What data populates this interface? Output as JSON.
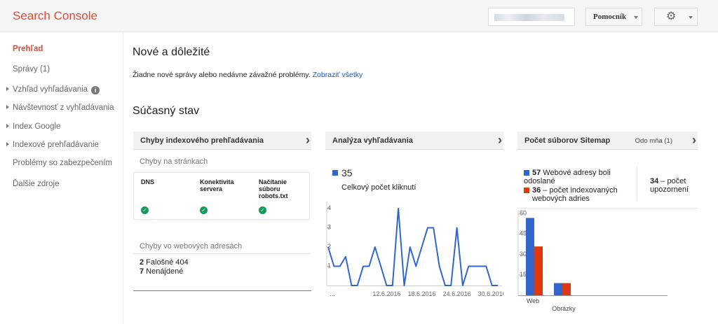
{
  "header": {
    "app_title": "Search Console",
    "help_label": "Pomocník"
  },
  "sidebar": {
    "items": [
      {
        "label": "Prehľad"
      },
      {
        "label": "Správy (1)"
      },
      {
        "label": "Vzhľad vyhľadávania"
      },
      {
        "label": "Návštevnosť z vyhľadávania"
      },
      {
        "label": "Index Google"
      },
      {
        "label": "Indexové prehľadávanie"
      },
      {
        "label": "Problémy so zabezpečením"
      },
      {
        "label": "Ďalšie zdroje"
      }
    ]
  },
  "main": {
    "news_title": "Nové a dôležité",
    "news_text": "Žiadne nové správy alebo nedávne závažné problémy.",
    "news_link": "Zobraziť všetky",
    "status_title": "Súčasný stav"
  },
  "crawl_errors": {
    "title": "Chyby indexového prehľadávania",
    "site_errors_label": "Chyby na stránkach",
    "columns": [
      {
        "lines": [
          "DNS"
        ]
      },
      {
        "lines": [
          "Konektivita",
          "servera"
        ]
      },
      {
        "lines": [
          "Načítanie",
          "súboru",
          "robots.txt"
        ]
      }
    ],
    "url_errors_label": "Chyby vo webových adresách",
    "url_errors": [
      {
        "count": "2",
        "label": " Falošné 404"
      },
      {
        "count": "7",
        "label": " Nenájdené"
      }
    ]
  },
  "search_analytics": {
    "title": "Analýza vyhľadávania",
    "total_clicks": "35",
    "total_clicks_label": "Celkový počet kliknutí"
  },
  "sitemaps": {
    "title": "Počet súborov Sitemap",
    "date_selector": "Odo mňa (1)",
    "submitted_count": "57",
    "submitted_label": " Webové adresy boli",
    "submitted_label_2": "odoslané",
    "indexed_count": "36",
    "indexed_label": " – počet indexovaných",
    "indexed_label_2": "webových adries",
    "warnings_count": "34",
    "warnings_label": " – počet",
    "warnings_label_2": "upozornení"
  },
  "colors": {
    "brand": "#dd4b39",
    "link": "#1155cc",
    "series_blue": "#3366cc",
    "series_red": "#dc3912",
    "ok_green": "#109d58"
  },
  "chart_data": [
    {
      "type": "line",
      "ylim": [
        0,
        4
      ],
      "y_ticks": [
        "1",
        "2",
        "3",
        "4"
      ],
      "x_ticks": [
        "...",
        "12.6.2016",
        "18.6.2016",
        "24.6.2016",
        "30.6.2016"
      ],
      "series": [
        {
          "values": [
            2,
            1,
            1,
            1.5,
            0,
            0,
            1,
            1,
            2,
            1,
            0,
            0,
            4,
            0,
            2,
            1,
            2,
            3,
            3,
            1,
            0,
            0,
            3,
            0,
            1,
            1,
            1,
            1,
            0,
            0
          ]
        }
      ]
    },
    {
      "type": "bar",
      "categories": [
        "Web",
        "Obrázky"
      ],
      "y_ticks": [
        "15",
        "30",
        "45",
        "60"
      ],
      "ylim": [
        0,
        60
      ],
      "series": [
        {
          "name": "Webové adresy boli odoslané",
          "values": [
            57,
            9
          ]
        },
        {
          "name": "počet indexovaných webových adries",
          "values": [
            36,
            9
          ]
        }
      ]
    }
  ]
}
